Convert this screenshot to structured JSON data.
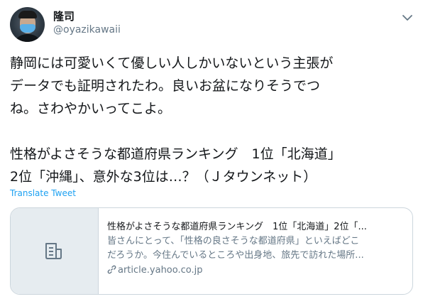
{
  "user": {
    "display_name": "隆司",
    "handle": "@oyazikawaii"
  },
  "tweet": {
    "lines_p1": [
      "静岡には可愛いくて優しい人しかいないという主張が",
      "データでも証明されたわ。良いお盆になりそうでつ",
      "ね。さわやかいってこよ。"
    ],
    "lines_p2": [
      "性格がよさそうな都道府県ランキング　1位「北海道」",
      "2位「沖縄」、意外な3位は…？（Ｊタウンネット）"
    ],
    "translate_label": "Translate Tweet"
  },
  "card": {
    "title": "性格がよさそうな都道府県ランキング　1位「北海道」2位「...",
    "desc_lines": [
      "皆さんにとって、「性格の良さそうな都道府県」といえばどこ",
      "だろうか。今住んでいるところや出身地、旅先で訪れた場所..."
    ],
    "domain": "article.yahoo.co.jp",
    "thumb_icon": "document-icon",
    "link_icon": "link-icon"
  },
  "icons": {
    "menu": "chevron-down-icon"
  },
  "colors": {
    "text": "#14171a",
    "secondary": "#657786",
    "accent": "#1da1f2",
    "border": "#ccd6dd",
    "thumb_bg": "#e6ecf0"
  }
}
